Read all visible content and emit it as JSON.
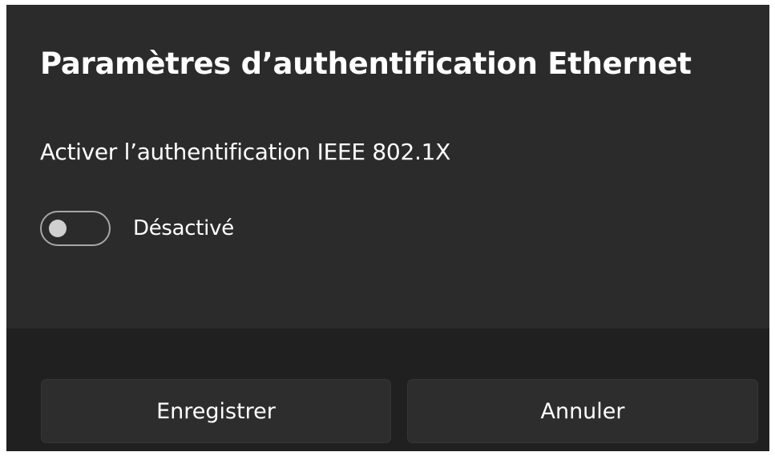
{
  "dialog": {
    "title": "Paramètres d’authentification Ethernet",
    "setting": {
      "label": "Activer l’authentification IEEE 802.1X",
      "toggle_state_label": "Désactivé",
      "enabled": false
    },
    "buttons": {
      "save_label": "Enregistrer",
      "cancel_label": "Annuler"
    }
  },
  "colors": {
    "content_background": "#2b2b2b",
    "footer_background": "#202020",
    "button_background": "#2d2d2d",
    "text": "#ffffff",
    "toggle_border": "#a6a6a6",
    "toggle_knob": "#d0d0d0"
  }
}
